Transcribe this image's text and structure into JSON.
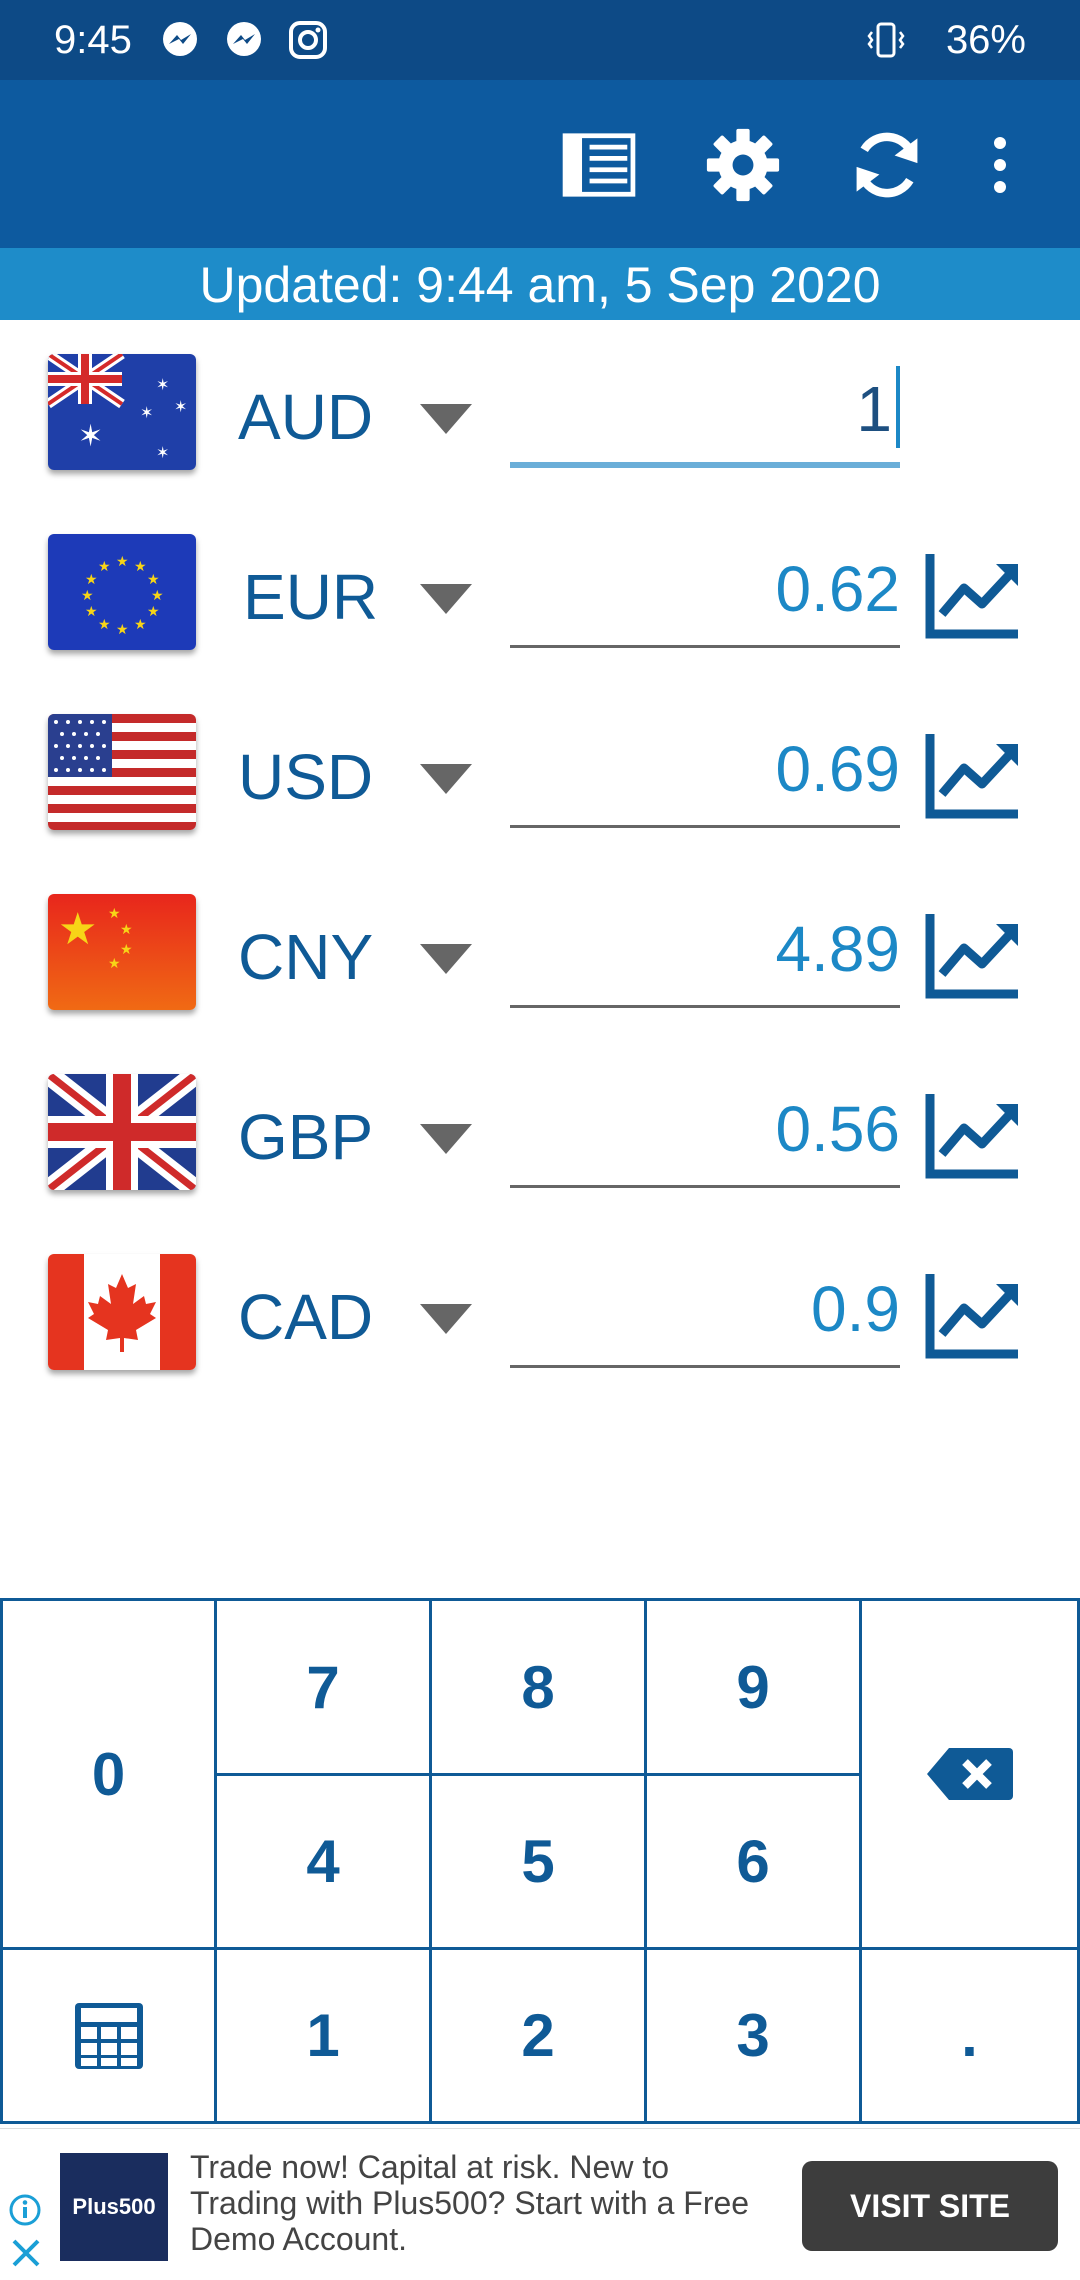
{
  "status_bar": {
    "time": "9:45",
    "battery": "36%",
    "icons": [
      "messenger-icon",
      "messenger-icon",
      "instagram-icon",
      "vibrate-icon"
    ]
  },
  "toolbar": {
    "icons": [
      "list-icon",
      "settings-gear-icon",
      "refresh-icon",
      "more-vert-icon"
    ]
  },
  "updated_text": "Updated: 9:44 am, 5 Sep 2020",
  "currencies": [
    {
      "code": "AUD",
      "value": "1",
      "active": true,
      "flag": "australia-flag"
    },
    {
      "code": "EUR",
      "value": "0.62",
      "active": false,
      "flag": "eu-flag"
    },
    {
      "code": "USD",
      "value": "0.69",
      "active": false,
      "flag": "usa-flag"
    },
    {
      "code": "CNY",
      "value": "4.89",
      "active": false,
      "flag": "china-flag"
    },
    {
      "code": "GBP",
      "value": "0.56",
      "active": false,
      "flag": "uk-flag"
    },
    {
      "code": "CAD",
      "value": "0.9",
      "active": false,
      "flag": "canada-flag"
    }
  ],
  "keypad": {
    "zero": "0",
    "seven": "7",
    "eight": "8",
    "nine": "9",
    "four": "4",
    "five": "5",
    "six": "6",
    "one": "1",
    "two": "2",
    "three": "3",
    "dot": "."
  },
  "ad": {
    "logo_text": "Plus500",
    "body": "Trade now! Capital at risk. New to Trading with Plus500? Start with a Free Demo Account.",
    "button": "VISIT SITE"
  },
  "colors": {
    "status_bar": "#0d4a86",
    "toolbar": "#0d5a9f",
    "updated_bar": "#1e8cc9",
    "accent": "#0f5a96",
    "value_text": "#1c88c6"
  }
}
